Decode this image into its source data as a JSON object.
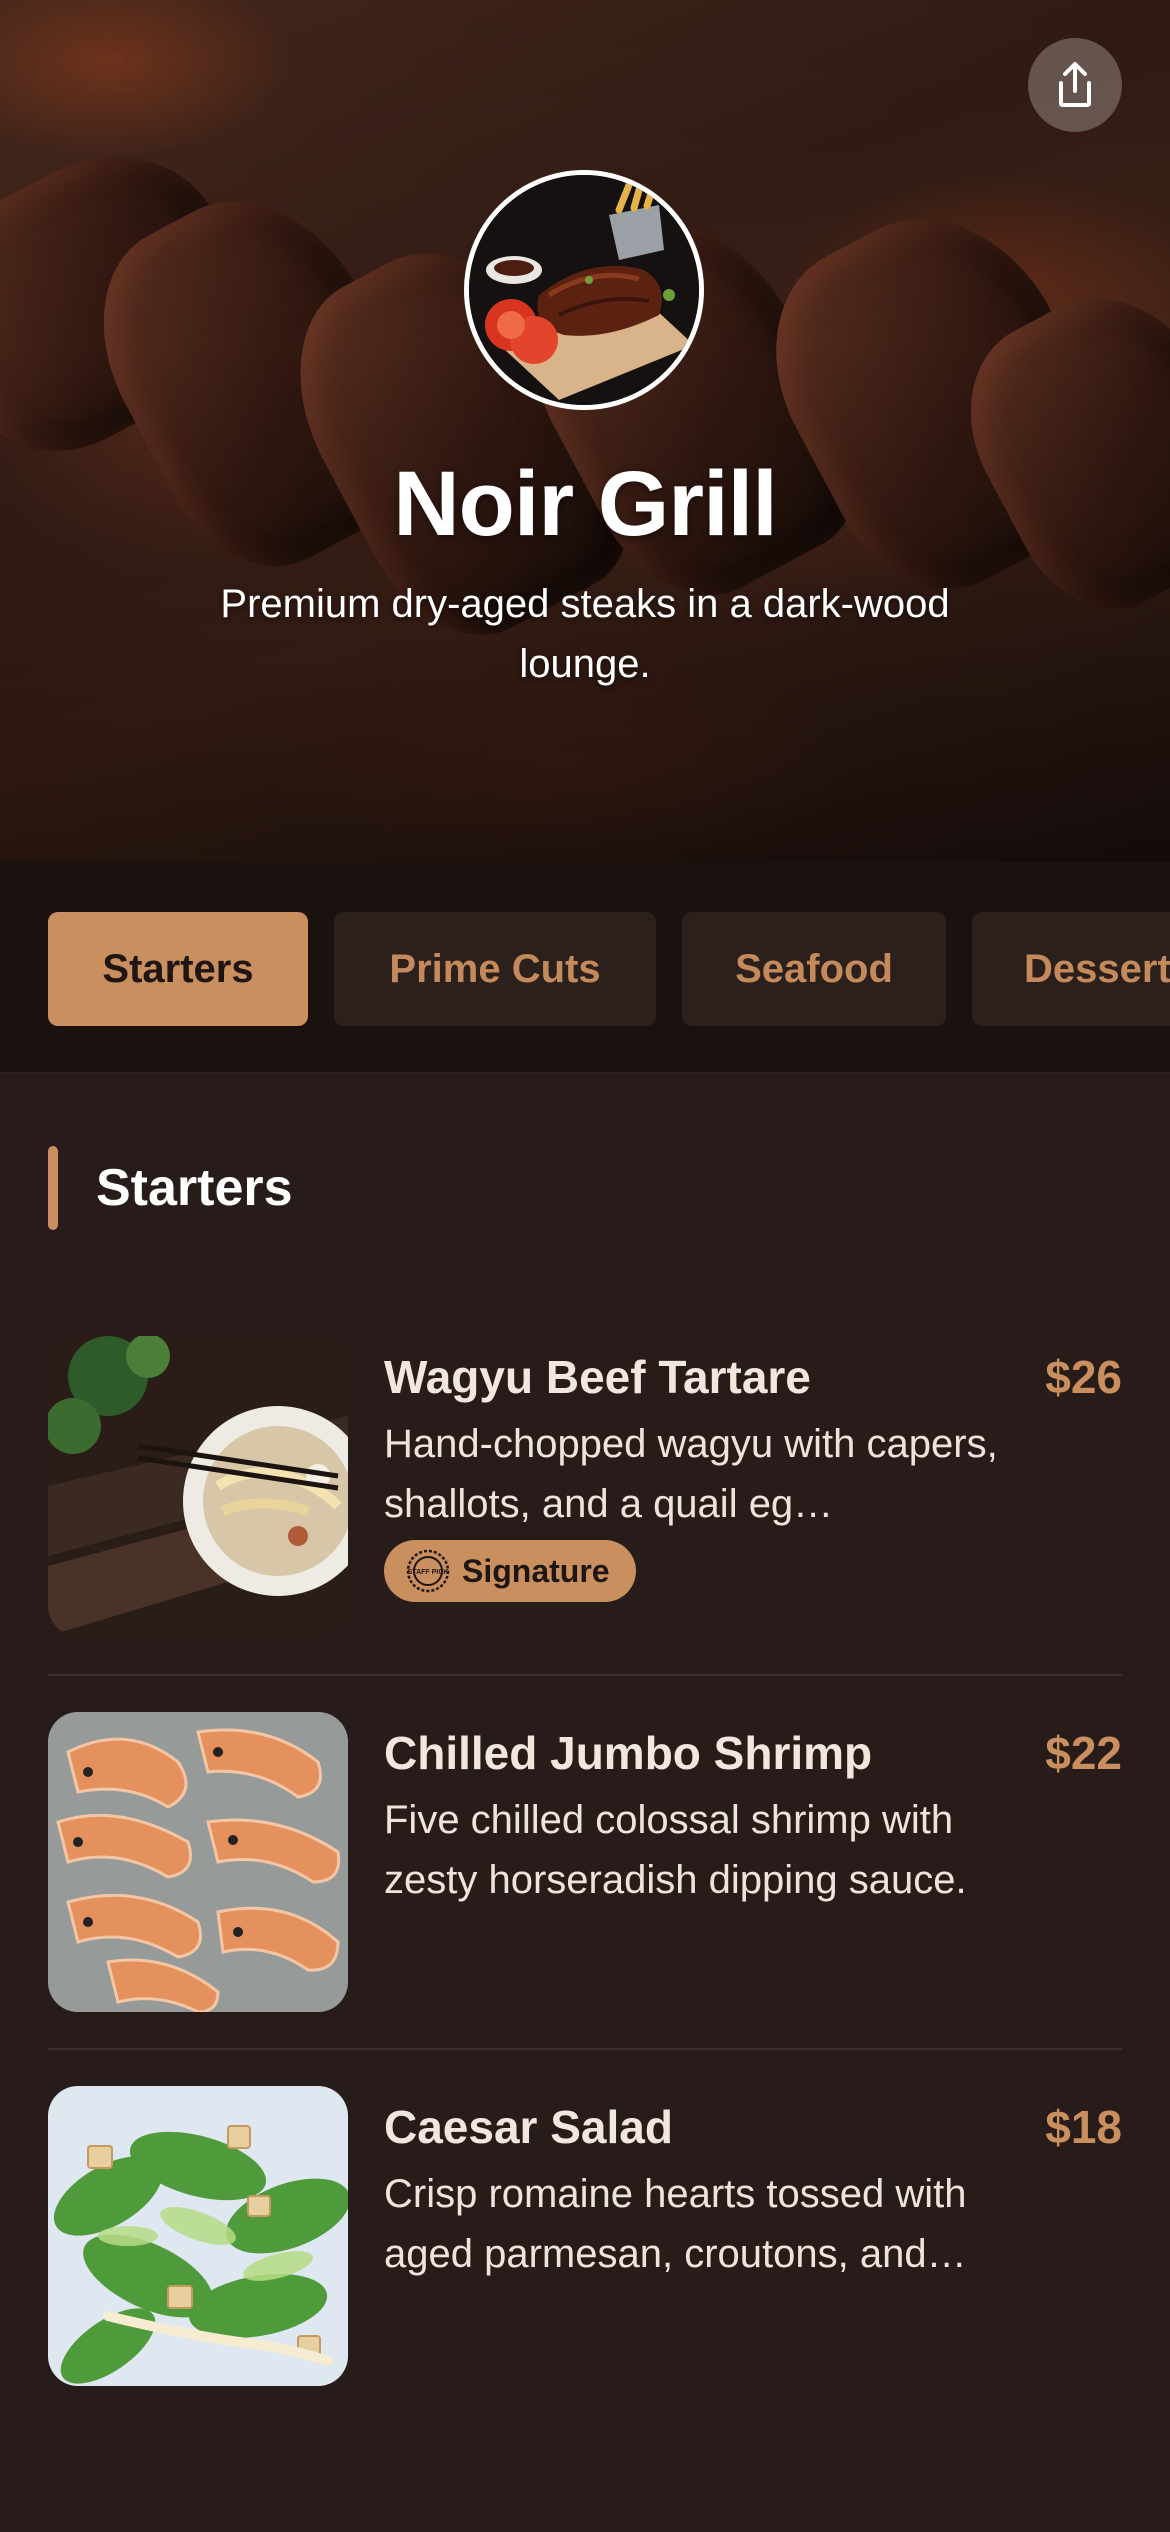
{
  "header": {
    "name": "Noir Grill",
    "tagline": "Premium dry-aged steaks in a dark-wood lounge."
  },
  "tabs": [
    {
      "label": "Starters",
      "active": true
    },
    {
      "label": "Prime Cuts",
      "active": false
    },
    {
      "label": "Seafood",
      "active": false
    },
    {
      "label": "Desserts",
      "active": false
    }
  ],
  "section": {
    "title": "Starters"
  },
  "items": [
    {
      "title": "Wagyu Beef Tartare",
      "price": "$26",
      "description": "Hand-chopped wagyu with capers, shallots, and a quail eg…",
      "badge": "Signature",
      "badge_icon_text": "STAFF PICK"
    },
    {
      "title": "Chilled Jumbo Shrimp",
      "price": "$22",
      "description": "Five chilled colossal shrimp with zesty horseradish dipping sauce."
    },
    {
      "title": "Caesar Salad",
      "price": "$18",
      "description": "Crisp romaine hearts tossed with aged parmesan, croutons, and…"
    }
  ],
  "icons": {
    "share": "share-icon",
    "badge": "staff-pick-seal-icon"
  },
  "colors": {
    "accent": "#c98f5f",
    "background": "#271c19",
    "tabbar": "#1b1210",
    "tab_inactive": "#2c201c"
  }
}
